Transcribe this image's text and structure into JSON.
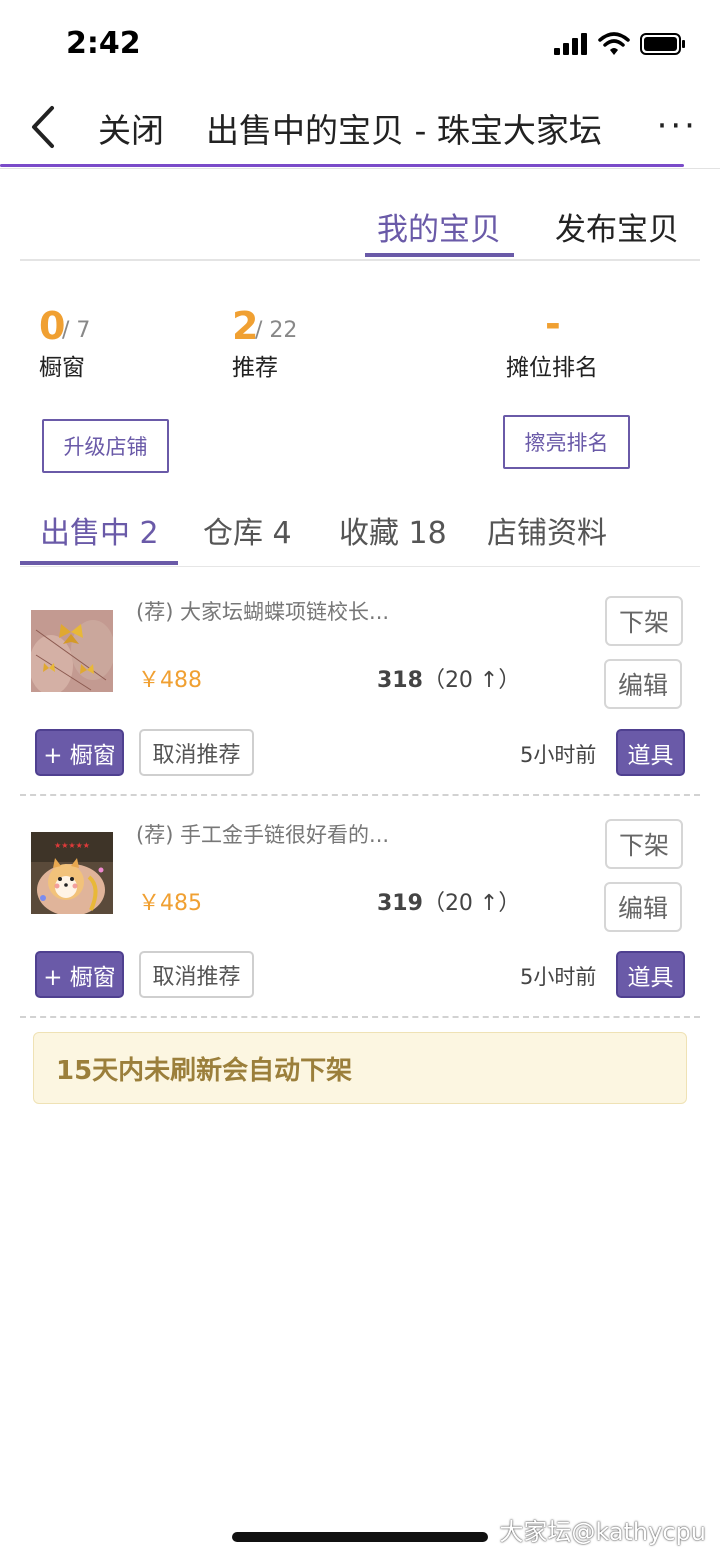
{
  "status_bar": {
    "time": "2:42"
  },
  "nav": {
    "close_label": "关闭",
    "title": "出售中的宝贝 - 珠宝大家坛",
    "more": "···"
  },
  "top_tabs": [
    {
      "label": "我的宝贝"
    },
    {
      "label": "发布宝贝"
    }
  ],
  "stats": {
    "window": {
      "value": "0",
      "total": "/ 7",
      "label": "橱窗"
    },
    "recommend": {
      "value": "2",
      "total": "/ 22",
      "label": "推荐"
    },
    "rank": {
      "value": "-",
      "label": "摊位排名"
    }
  },
  "buttons": {
    "upgrade": "升级店铺",
    "polish_rank": "擦亮排名"
  },
  "section_tabs": [
    {
      "label": "出售中 2"
    },
    {
      "label": "仓库 4"
    },
    {
      "label": "收藏 18"
    },
    {
      "label": "店铺资料"
    }
  ],
  "items": [
    {
      "title": "(荐) 大家坛蝴蝶项链校长...",
      "price": "￥488",
      "views": "318",
      "up": "（20 ↑）",
      "time": "5小时前",
      "btn_delist": "下架",
      "btn_edit": "编辑",
      "btn_window": "+ 橱窗",
      "btn_unrecommend": "取消推荐",
      "btn_tools": "道具"
    },
    {
      "title": "(荐) 手工金手链很好看的...",
      "price": "￥485",
      "views": "319",
      "up": "（20 ↑）",
      "time": "5小时前",
      "btn_delist": "下架",
      "btn_edit": "编辑",
      "btn_window": "+ 橱窗",
      "btn_unrecommend": "取消推荐",
      "btn_tools": "道具"
    }
  ],
  "notice": "15天内未刷新会自动下架",
  "watermark": "大家坛@kathycpu",
  "colors": {
    "accent": "#6a5aa8",
    "orange": "#f0a032",
    "notice_bg": "#fcf6e1"
  }
}
